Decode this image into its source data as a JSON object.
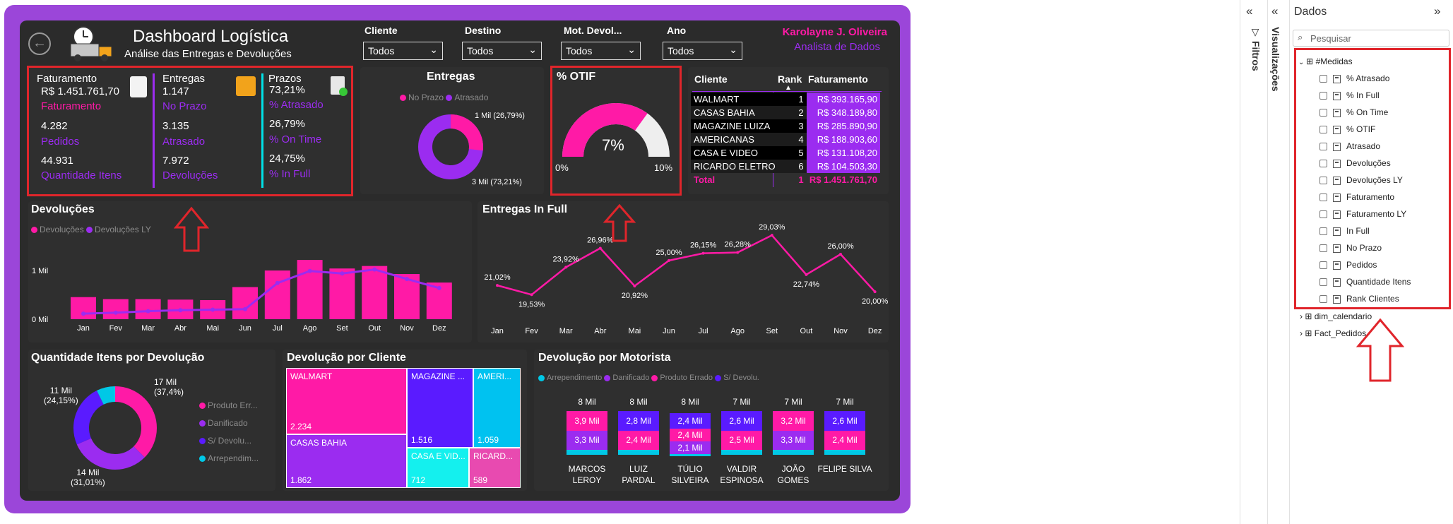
{
  "header": {
    "title": "Dashboard Logística",
    "subtitle": "Análise das Entregas e Devoluções",
    "author": "Karolayne J. Oliveira",
    "author_role": "Analista de Dados"
  },
  "slicers": [
    {
      "label": "Cliente",
      "value": "Todos"
    },
    {
      "label": "Destino",
      "value": "Todos"
    },
    {
      "label": "Mot. Devol...",
      "value": "Todos"
    },
    {
      "label": "Ano",
      "value": "Todos"
    }
  ],
  "kpi": {
    "faturamento": {
      "title": "Faturamento",
      "v1": "R$ 1.451.761,70",
      "l1": "Faturamento",
      "v2": "4.282",
      "l2": "Pedidos",
      "v3": "44.931",
      "l3": "Quantidade Itens"
    },
    "entregas": {
      "title": "Entregas",
      "v1": "1.147",
      "l1": "No Prazo",
      "v2": "3.135",
      "l2": "Atrasado",
      "v3": "7.972",
      "l3": "Devoluções"
    },
    "prazos": {
      "title": "Prazos",
      "v1": "73,21%",
      "l1": "% Atrasado",
      "v2": "26,79%",
      "l2": "% On Time",
      "v3": "24,75%",
      "l3": "% In Full"
    }
  },
  "entregas_donut": {
    "title": "Entregas",
    "legend": [
      "No Prazo",
      "Atrasado"
    ],
    "label_small": "1 Mil (26,79%)",
    "label_large": "3 Mil (73,21%)",
    "colors": {
      "no_prazo": "#ff1aa6",
      "atrasado": "#9b2cf0"
    }
  },
  "otif": {
    "title": "% OTIF",
    "value": "7%",
    "min": "0%",
    "max": "10%",
    "fraction": 0.7
  },
  "rank_table": {
    "headers": [
      "Cliente",
      "Rank",
      "Faturamento"
    ],
    "rows": [
      {
        "cliente": "WALMART",
        "rank": "1",
        "fat": "R$ 393.165,90"
      },
      {
        "cliente": "CASAS BAHIA",
        "rank": "2",
        "fat": "R$ 348.189,80"
      },
      {
        "cliente": "MAGAZINE LUIZA",
        "rank": "3",
        "fat": "R$ 285.890,90"
      },
      {
        "cliente": "AMERICANAS",
        "rank": "4",
        "fat": "R$ 188.903,60"
      },
      {
        "cliente": "CASA E VIDEO",
        "rank": "5",
        "fat": "R$ 131.108,20"
      },
      {
        "cliente": "RICARDO ELETRO",
        "rank": "6",
        "fat": "R$ 104.503,30"
      }
    ],
    "total": {
      "label": "Total",
      "rank": "1",
      "fat": "R$ 1.451.761,70"
    }
  },
  "devolucoes_chart": {
    "title": "Devoluções",
    "legend": [
      "Devoluções",
      "Devoluções LY"
    ],
    "ytick_top": "1 Mil",
    "ytick_bottom": "0 Mil"
  },
  "entregas_infull": {
    "title": "Entregas In Full"
  },
  "qtd_itens": {
    "title": "Quantidade Itens por Devolução",
    "labels": {
      "a": "17 Mil",
      "a2": "(37,4%)",
      "b": "14 Mil",
      "b2": "(31,01%)",
      "c": "11 Mil",
      "c2": "(24,15%)"
    },
    "legend": [
      "Produto Err...",
      "Danificado",
      "S/ Devolu...",
      "Arrependim..."
    ]
  },
  "treemap": {
    "title": "Devolução por Cliente",
    "cells": [
      {
        "name": "WALMART",
        "value": "2.234"
      },
      {
        "name": "MAGAZINE ...",
        "value": "1.516"
      },
      {
        "name": "AMERI...",
        "value": "1.059"
      },
      {
        "name": "CASAS BAHIA",
        "value": "1.862"
      },
      {
        "name": "CASA E VID...",
        "value": "712"
      },
      {
        "name": "RICARD...",
        "value": "589"
      }
    ]
  },
  "motorista": {
    "title": "Devolução por Motorista",
    "legend": [
      "Arrependimento",
      "Danificado",
      "Produto Errado",
      "S/ Devolu."
    ],
    "drivers": [
      {
        "name1": "MARCOS",
        "name2": "LEROY",
        "total": "8 Mil",
        "top": "3,9 Mil",
        "bottom": "3,3 Mil",
        "extra": ""
      },
      {
        "name1": "LUIZ",
        "name2": "PARDAL",
        "total": "8 Mil",
        "top": "2,8 Mil",
        "bottom": "2,4 Mil",
        "extra": ""
      },
      {
        "name1": "TÚLIO",
        "name2": "SILVEIRA",
        "total": "8 Mil",
        "top": "2,4 Mil",
        "bottom": "2,4 Mil",
        "extra": "2,1 Mil"
      },
      {
        "name1": "VALDIR",
        "name2": "ESPINOSA",
        "total": "7 Mil",
        "top": "2,6 Mil",
        "bottom": "2,5 Mil",
        "extra": ""
      },
      {
        "name1": "JOÃO",
        "name2": "GOMES",
        "total": "7 Mil",
        "top": "3,2 Mil",
        "bottom": "3,3 Mil",
        "extra": ""
      },
      {
        "name1": "FELIPE SILVA",
        "name2": "",
        "total": "7 Mil",
        "top": "2,6 Mil",
        "bottom": "2,4 Mil",
        "extra": ""
      }
    ]
  },
  "chart_data": [
    {
      "type": "bar",
      "title": "Devoluções",
      "categories": [
        "Jan",
        "Fev",
        "Mar",
        "Abr",
        "Mai",
        "Jun",
        "Jul",
        "Ago",
        "Set",
        "Out",
        "Nov",
        "Dez"
      ],
      "series": [
        {
          "name": "Devoluções",
          "values": [
            440,
            400,
            400,
            390,
            380,
            640,
            970,
            1180,
            1010,
            1060,
            900,
            730
          ]
        },
        {
          "name": "Devoluções LY",
          "values": [
            110,
            130,
            160,
            180,
            190,
            200,
            720,
            960,
            910,
            990,
            800,
            620
          ]
        }
      ],
      "ylim": [
        0,
        1400
      ]
    },
    {
      "type": "line",
      "title": "Entregas In Full",
      "categories": [
        "Jan",
        "Fev",
        "Mar",
        "Abr",
        "Mai",
        "Jun",
        "Jul",
        "Ago",
        "Set",
        "Out",
        "Nov",
        "Dez"
      ],
      "values": [
        21.02,
        19.53,
        23.92,
        26.96,
        20.92,
        25.0,
        26.15,
        26.28,
        29.03,
        22.74,
        26.0,
        20.0
      ],
      "labels": [
        "21,02%",
        "19,53%",
        "23,92%",
        "26,96%",
        "20,92%",
        "25,00%",
        "26,15%",
        "26,28%",
        "29,03%",
        "22,74%",
        "26,00%",
        "20,00%"
      ]
    },
    {
      "type": "pie",
      "title": "Quantidade Itens por Devolução",
      "categories": [
        "Produto Errado",
        "Danificado",
        "S/ Devolução",
        "Arrependimento"
      ],
      "values": [
        37.4,
        31.01,
        24.15,
        7.44
      ]
    }
  ],
  "side_panels": {
    "filtros": "Filtros",
    "visualizacoes": "Visualizações",
    "dados_title": "Dados",
    "search_placeholder": "Pesquisar",
    "group": "#Medidas",
    "measures": [
      "% Atrasado",
      "% In Full",
      "% On Time",
      "% OTIF",
      "Atrasado",
      "Devoluções",
      "Devoluções LY",
      "Faturamento",
      "Faturamento LY",
      "In Full",
      "No Prazo",
      "Pedidos",
      "Quantidade Itens",
      "Rank Clientes"
    ],
    "tables": [
      "dim_calendario",
      "Fact_Pedidos"
    ]
  },
  "colors": {
    "pink": "#ff1aa6",
    "purple": "#9b2cf0",
    "cyan": "#00c8e6",
    "red": "#e0252b"
  }
}
